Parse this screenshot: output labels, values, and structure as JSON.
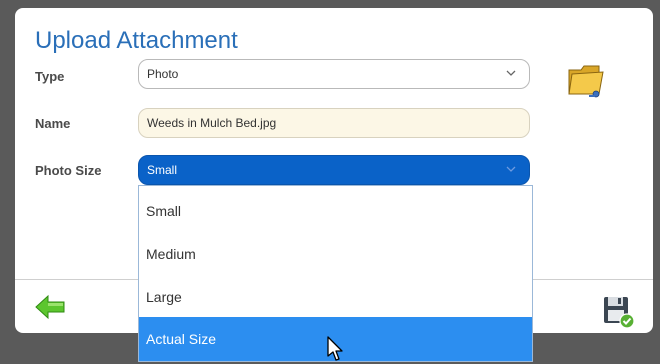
{
  "dialog": {
    "title": "Upload Attachment"
  },
  "form": {
    "type_label": "Type",
    "type_value": "Photo",
    "name_label": "Name",
    "name_value": "Weeds in Mulch Bed.jpg",
    "size_label": "Photo Size",
    "size_value": "Small"
  },
  "dropdown": {
    "options": [
      "Small",
      "Medium",
      "Large",
      "Actual Size"
    ],
    "highlighted": "Actual Size"
  },
  "icons": {
    "browse": "folder-icon",
    "back": "green-left-arrow-icon",
    "save": "floppy-disk-check-icon"
  },
  "colors": {
    "title": "#2a6fb8",
    "selected_select": "#0a62c8",
    "highlight_option": "#2c8ef0",
    "readonly_field": "#fcf7e6"
  }
}
